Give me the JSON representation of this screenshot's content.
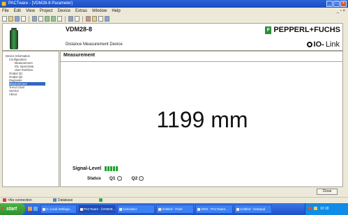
{
  "window": {
    "title": "PACTware - [VDM28-8 Parameter]",
    "controls": [
      "_",
      "□",
      "×"
    ]
  },
  "menu": [
    "File",
    "Edit",
    "View",
    "Project",
    "Device",
    "Extras",
    "Window",
    "Help"
  ],
  "device": {
    "name": "VDM28-8",
    "description": "Distance Measurement Device",
    "brand": "PEPPERL+FUCHS",
    "brand_flag": "F",
    "protocol_io": "IO-",
    "protocol_link": "Link"
  },
  "nav": [
    {
      "label": "Device Information",
      "indent": 0,
      "selected": false
    },
    {
      "label": "Configuration",
      "indent": 1,
      "selected": false
    },
    {
      "label": "Measurement",
      "indent": 2,
      "selected": false
    },
    {
      "label": "IOL Input Data",
      "indent": 2,
      "selected": false
    },
    {
      "label": "User Interface",
      "indent": 2,
      "selected": false
    },
    {
      "label": "Output Q1",
      "indent": 1,
      "selected": false
    },
    {
      "label": "Output Q2",
      "indent": 1,
      "selected": false
    },
    {
      "label": "Diagnosis",
      "indent": 1,
      "selected": false
    },
    {
      "label": "Measurement",
      "indent": 1,
      "selected": true
    },
    {
      "label": "Trend Chart",
      "indent": 1,
      "selected": false
    },
    {
      "label": "Service",
      "indent": 1,
      "selected": false
    },
    {
      "label": "About",
      "indent": 1,
      "selected": false
    }
  ],
  "main": {
    "title": "Measurement",
    "value": "1199 mm",
    "signal_label": "Signal-Level",
    "signal_segments": 5,
    "status_label": "Status",
    "q1_label": "Q1",
    "q2_label": "Q2",
    "close_label": "Close"
  },
  "statusbar": {
    "connection": "<No connection",
    "database": "Database",
    "path": "<NONAME>",
    "user": "Administrator"
  },
  "taskbar": {
    "start": "start",
    "tasks": [
      "A: Local Settings...",
      "PACTware - [VDM28...",
      "Calculator",
      "Untitled - Paint",
      "VDM - PACTware...",
      "Untitled - Notepad"
    ],
    "clock": "10:18"
  },
  "colors": {
    "selection": "#316AC5",
    "signal_green": "#22A22E",
    "brand_green": "#2E8B3A",
    "title_blue": "#2A62D6"
  }
}
